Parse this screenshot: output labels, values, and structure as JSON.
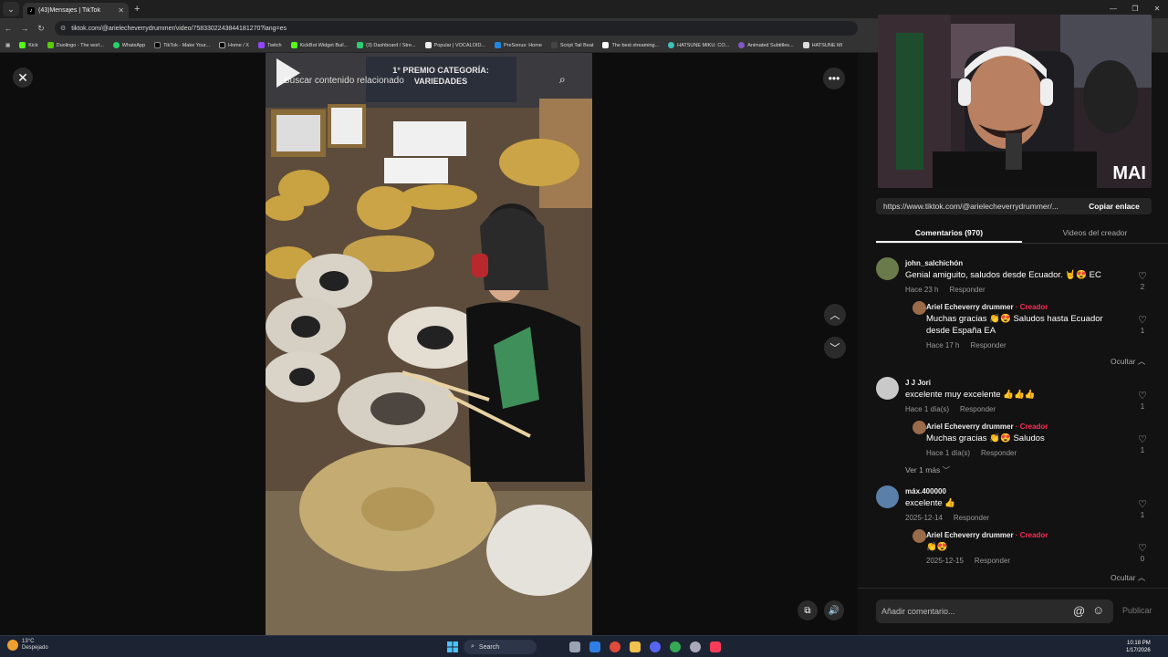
{
  "browser": {
    "tab_title": "(43)Mensajes | TikTok",
    "url": "tiktok.com/@arielecheverrydrummer/video/7583302243844181270?lang=es",
    "bookmarks": [
      "Kick",
      "Duolingo - The worl...",
      "WhatsApp",
      "TikTok - Make Your...",
      "Home / X",
      "Twitch",
      "KickBot Widget Buil...",
      "(3) Dashboard / Stre...",
      "Popular | VOCALOID...",
      "PreSonus: Home",
      "Script Tail Beat",
      "The best streaming...",
      "HATSUNE MIKU: CO...",
      "Animated Subtitles...",
      "HATSUNE MI"
    ]
  },
  "video": {
    "search_placeholder": "Buscar contenido relacionado",
    "banner_text": "1° PREMIO CATEGORÍA: VARIEDADES"
  },
  "webcam": {
    "overlay_logo": "MAI"
  },
  "share": {
    "link": "https://www.tiktok.com/@arielecheverrydrummer/...",
    "copy_label": "Copiar enlace"
  },
  "tabs": {
    "comments": "Comentarios (970)",
    "creator_videos": "Videos del creador"
  },
  "comments": [
    {
      "user": "john_salchichón",
      "text": "Genial amiguito, saludos desde Ecuador. 🤘😍 EC",
      "time": "Hace 23 h",
      "reply": "Responder",
      "likes": "2",
      "replies": [
        {
          "user": "Ariel Echeverry drummer",
          "badge": "· Creador",
          "text1": "Muchas gracias 👏😍 Saludos hasta Ecuador",
          "text2": "desde España EA",
          "time": "Hace 17 h",
          "reply": "Responder",
          "likes": "1"
        }
      ],
      "toggle": "Ocultar"
    },
    {
      "user": "J J Jori",
      "text": "excelente muy excelente 👍👍👍",
      "time": "Hace 1 día(s)",
      "reply": "Responder",
      "likes": "1",
      "replies": [
        {
          "user": "Ariel Echeverry drummer",
          "badge": "· Creador",
          "text1": "Muchas gracias 👏😍 Saludos",
          "time": "Hace 1 día(s)",
          "reply": "Responder",
          "likes": "1"
        }
      ],
      "toggle": "Ver 1 más"
    },
    {
      "user": "máx.400000",
      "text": "excelente 👍",
      "time": "2025-12-14",
      "reply": "Responder",
      "likes": "1",
      "replies": [
        {
          "user": "Ariel Echeverry drummer",
          "badge": "· Creador",
          "text1": "👏😍",
          "time": "2025-12-15",
          "reply": "Responder",
          "likes": "0"
        }
      ],
      "toggle": "Ocultar"
    }
  ],
  "add_comment": {
    "placeholder": "Añadir comentario...",
    "publish": "Publicar"
  },
  "taskbar": {
    "temp": "13°C",
    "weather": "Despejado",
    "search": "Search",
    "time": "10:18 PM",
    "date": "1/17/2026"
  },
  "colors": {
    "creator": "#fe2c55",
    "background": "#0f0f0f"
  }
}
